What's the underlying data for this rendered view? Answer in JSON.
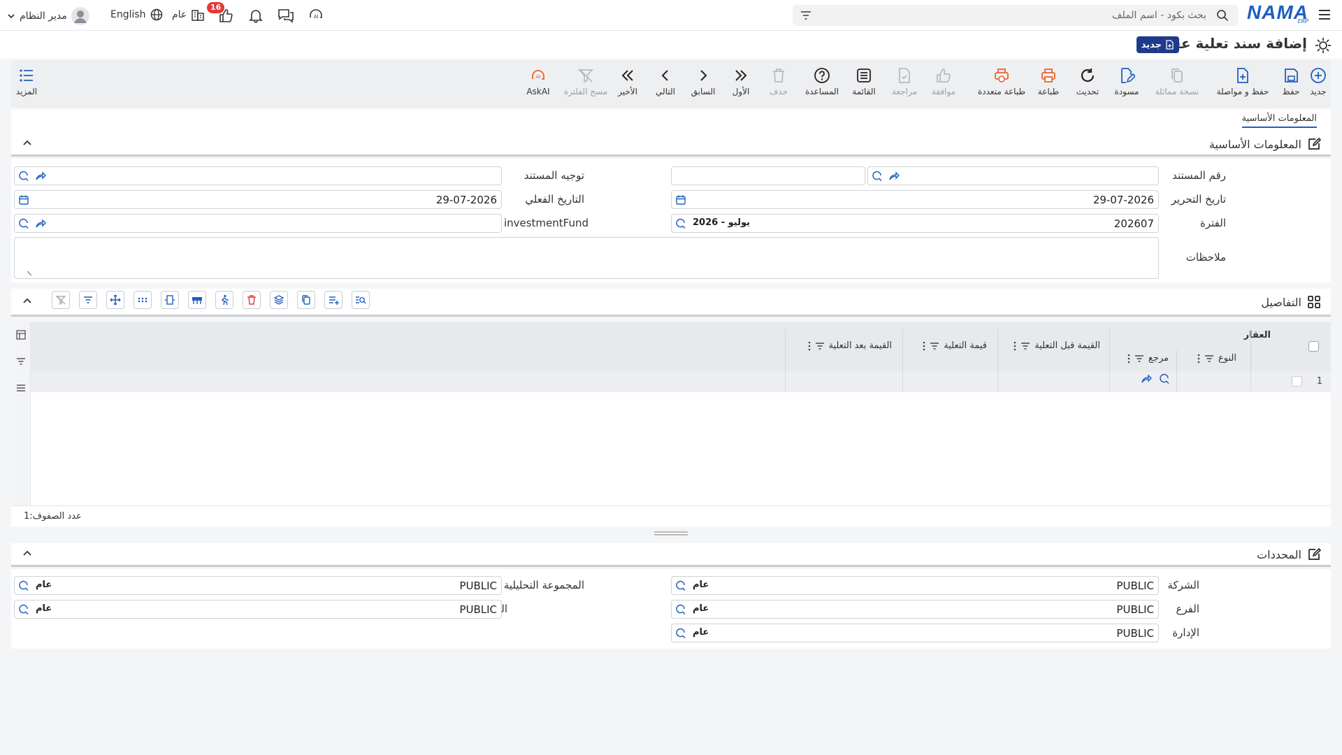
{
  "topbar": {
    "menu_icon": "hamburger-icon",
    "logo": "NAMA",
    "logo_sub": "ERP",
    "search_placeholder": "بحث بكود - اسم الملف",
    "user_name": "مدير النظام",
    "language": "English",
    "scope": "عام",
    "badge_count": "16"
  },
  "title": {
    "page_title": "إضافة سند تعلية عقار",
    "status_badge": "جديد"
  },
  "toolbar": {
    "new": "جديد",
    "save": "حفظ",
    "save_continue": "حفظ و مواصلة",
    "copy": "نسخة مماثلة",
    "draft": "مسودة",
    "refresh": "تحديث",
    "print": "طباعة",
    "multi_print": "طباعة متعددة",
    "approve": "موافقة",
    "review": "مراجعة",
    "list": "القائمة",
    "help": "المساعدة",
    "delete": "حذف",
    "first": "الأول",
    "previous": "السابق",
    "next": "التالي",
    "last": "الأخير",
    "clear_filter": "مسح الفلترة",
    "askai": "AskAI",
    "more": "المزيد"
  },
  "tabs": {
    "basic": "المعلومات الأساسية"
  },
  "basic_section": {
    "title": "المعلومات الأساسية",
    "doc_number_label": "رقم المستند",
    "doc_number_value": "",
    "doc_direction_label": "توجيه المستند",
    "doc_direction_value": "",
    "edit_date_label": "تاريخ التحرير",
    "edit_date_value": "29-07-2026",
    "actual_date_label": "التاريخ الفعلي",
    "actual_date_value": "29-07-2026",
    "period_label": "الفترة",
    "period_value": "202607",
    "period_tag": "2026 - يوليو",
    "fund_label": "investmentFund",
    "fund_required": "*",
    "fund_value": "",
    "notes_label": "ملاحظات",
    "notes_value": ""
  },
  "details_section": {
    "title": "التفاصيل",
    "group_header": "العقار",
    "col_type": "النوع",
    "col_ref": "مرجع",
    "col_before": "القيمة قبل التعلية",
    "col_raise": "قيمة التعلية",
    "col_after": "القيمة بعد التعلية",
    "row_number": "1",
    "row_count_label": "عدد الصفوف:",
    "row_count": "1"
  },
  "dimensions_section": {
    "title": "المحددات",
    "company_label": "الشركة",
    "company_value": "PUBLIC",
    "company_tag": "عام",
    "branch_label": "الفرع",
    "branch_value": "PUBLIC",
    "branch_tag": "عام",
    "department_label": "الإدارة",
    "department_value": "PUBLIC",
    "department_tag": "عام",
    "analytic_label": "المجموعة التحليلية",
    "analytic_value": "PUBLIC",
    "analytic_tag": "عام",
    "sector_label": "القطاع",
    "sector_value": "PUBLIC",
    "sector_tag": "عام"
  },
  "colors": {
    "primary": "#1f5fbf",
    "orange": "#e8642c",
    "badge_red": "#e53935",
    "navy": "#1e3a8a"
  }
}
